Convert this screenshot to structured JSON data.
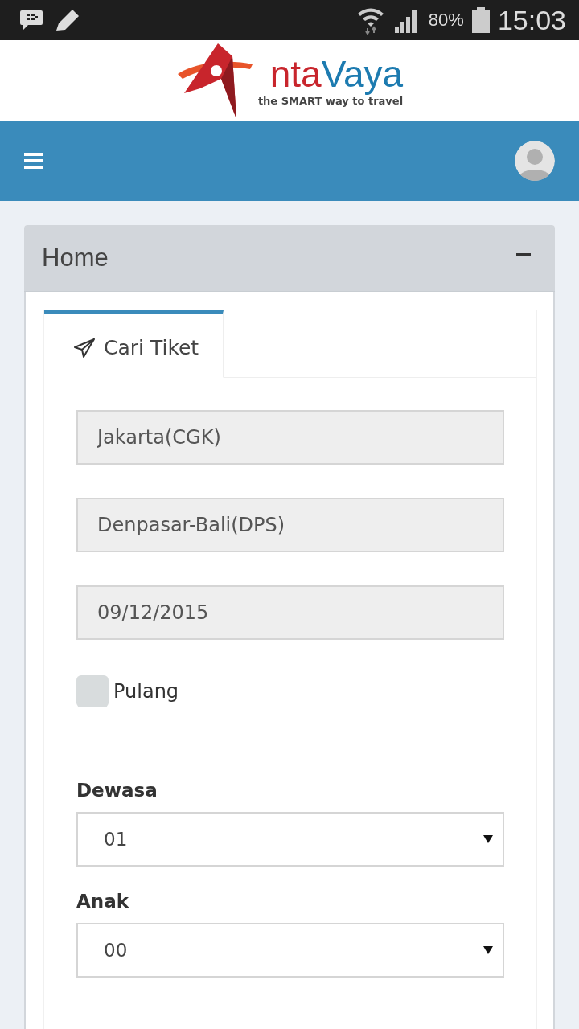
{
  "status_bar": {
    "battery": "80%",
    "time": "15:03"
  },
  "logo": {
    "wordmark_red": "nta",
    "wordmark_blue": "Vaya",
    "tagline": "the SMART way to travel"
  },
  "panel": {
    "title": "Home",
    "expanded": true
  },
  "tabs": [
    {
      "label": "Cari Tiket",
      "selected": true
    }
  ],
  "fields": [
    {
      "kind": "text",
      "value": "Jakarta(CGK)"
    },
    {
      "kind": "text",
      "value": "Denpasar-Bali(DPS)"
    },
    {
      "kind": "text",
      "value": "09/12/2015"
    },
    {
      "kind": "checkbox",
      "label": "Pulang",
      "checked": false
    },
    {
      "kind": "select",
      "label": "Dewasa",
      "value": "01"
    },
    {
      "kind": "select",
      "label": "Anak",
      "value": "00"
    }
  ]
}
